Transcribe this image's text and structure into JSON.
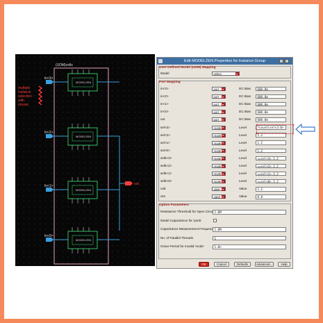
{
  "schematic": {
    "instance_title": "(UDM)cells",
    "left_labels": [
      "ln<3>",
      "ln<2>",
      "ln<1>",
      "ln<0>"
    ],
    "right_label": "out",
    "cell_name": "MODELZEN",
    "annotation": [
      "multiple",
      "instance",
      "selection",
      "with",
      "mouse"
    ],
    "accent": "#ff3b3b",
    "wire": "#3aa0e0",
    "cell_stroke": "#30c060"
  },
  "dialog": {
    "title": "Edit MODELZEN Properties for Instance Group",
    "udm": {
      "section": "User-Defined Model (UDM) Mapping",
      "model_label": "Model",
      "model_value": "select"
    },
    "ports": {
      "section": "Port Mapping",
      "rows": [
        {
          "name": "in<3>",
          "type": "port",
          "kind": "DC Bias",
          "value": "600.0m"
        },
        {
          "name": "in<2>",
          "type": "port",
          "kind": "DC Bias",
          "value": "600.0m"
        },
        {
          "name": "in<1>",
          "type": "port",
          "kind": "DC Bias",
          "value": "600.0m"
        },
        {
          "name": "in<0>",
          "type": "port",
          "kind": "DC Bias",
          "value": "600.0m"
        },
        {
          "name": "out",
          "type": "port",
          "kind": "DC Bias",
          "value": "600.0m"
        },
        {
          "name": "sel<3>",
          "type": "mode",
          "kind": "Level",
          "value": "?count(sel<3:0>"
        },
        {
          "name": "sel<2>",
          "type": "mode",
          "kind": "Level",
          "value": "1.2"
        },
        {
          "name": "sel<1>",
          "type": "mode",
          "kind": "Level",
          "value": "1.2"
        },
        {
          "name": "sel<0>",
          "type": "mode",
          "kind": "Level",
          "value": "1.2"
        },
        {
          "name": "selb<3>",
          "type": "mode",
          "kind": "Level",
          "value": "==sel<3>,1.2"
        },
        {
          "name": "selb<2>",
          "type": "mode",
          "kind": "Level",
          "value": "==sel<2>,1.2"
        },
        {
          "name": "selb<1>",
          "type": "mode",
          "kind": "Level",
          "value": "==sel<1>,1.2"
        },
        {
          "name": "selb<0>",
          "type": "mode",
          "kind": "Level",
          "value": "==sel<0>,1.2"
        },
        {
          "name": "vdd",
          "type": "vpwr",
          "kind": "Value",
          "value": "1.2"
        },
        {
          "name": "vss",
          "type": "vgnd",
          "kind": "Value",
          "value": "0.0"
        }
      ]
    },
    "options": {
      "section": "Option Parameters",
      "rows": [
        {
          "label": "Resistance Threshold for Open Circuits",
          "value": "1.0M",
          "kind": "field"
        },
        {
          "label": "Model Capacitance for 'ports'",
          "value": "",
          "kind": "check"
        },
        {
          "label": "Capacitance Measurement Frequency",
          "value": "1.0M",
          "kind": "field"
        },
        {
          "label": "No. of Parallel Threads",
          "value": "1",
          "kind": "field"
        },
        {
          "label": "Grace Period for Invalid 'mode'",
          "value": "1.0n",
          "kind": "field"
        }
      ]
    },
    "buttons": {
      "ok": "OK",
      "cancel": "Cancel",
      "defaults": "Defaults",
      "advanced": "Advanced...",
      "help": "Help"
    },
    "highlight_color": "#d01414",
    "callout_color": "#3d7cc9"
  }
}
